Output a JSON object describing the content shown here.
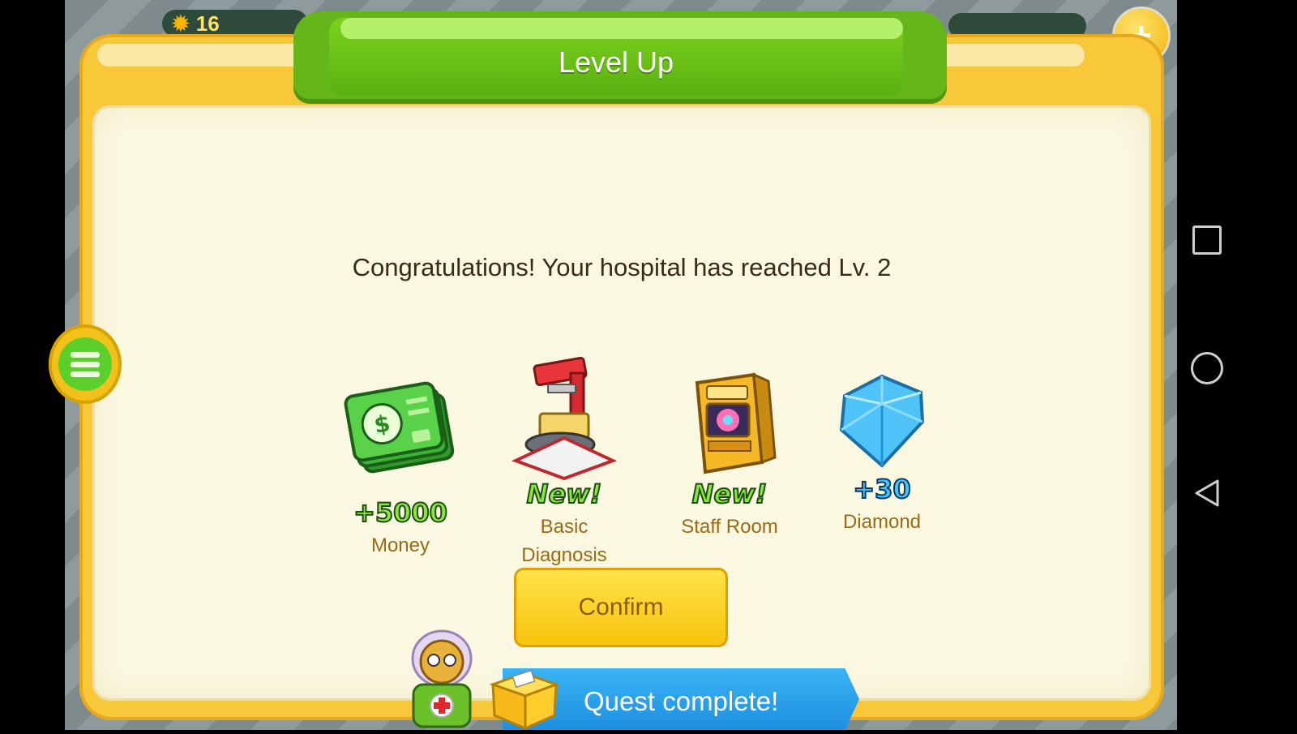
{
  "hud": {
    "level": "16"
  },
  "dialog": {
    "title": "Level Up",
    "message": "Congratulations! Your hospital has reached Lv. 2",
    "rewards": [
      {
        "badge": "+5000",
        "label": "Money",
        "icon": "money-icon"
      },
      {
        "badge": "New!",
        "label": "Basic Diagnosis",
        "label_lines": [
          "Basic",
          "Diagnosis"
        ],
        "icon": "diagnosis-machine-icon"
      },
      {
        "badge": "New!",
        "label": "Staff Room",
        "icon": "arcade-machine-icon"
      },
      {
        "badge": "+30",
        "label": "Diamond",
        "icon": "diamond-icon"
      }
    ],
    "confirm_label": "Confirm"
  },
  "quest": {
    "text": "Quest complete!"
  },
  "colors": {
    "accent_green": "#64b61a",
    "panel_yellow": "#f9c83a",
    "panel_cream": "#fbf8e2",
    "button_yellow": "#f7c40d",
    "banner_blue": "#1e8fe0"
  }
}
